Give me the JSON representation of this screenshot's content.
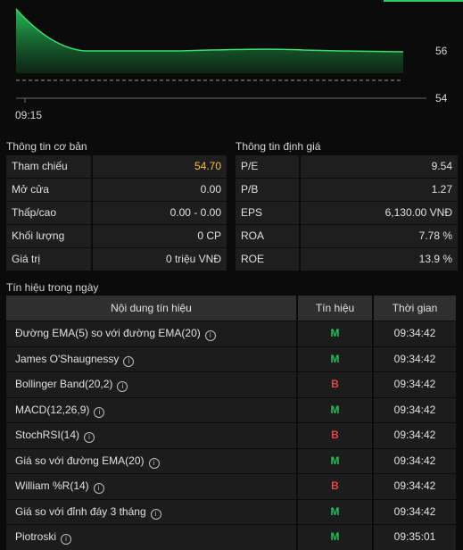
{
  "chart": {
    "y_ticks": [
      "56",
      "54"
    ],
    "x_ticks": [
      "09:15"
    ]
  },
  "basic": {
    "title": "Thông tin cơ bản",
    "rows": [
      {
        "label": "Tham chiếu",
        "value": "54.70"
      },
      {
        "label": "Mở cửa",
        "value": "0.00"
      },
      {
        "label": "Thấp/cao",
        "value": "0.00 - 0.00"
      },
      {
        "label": "Khối lượng",
        "value": "0 CP"
      },
      {
        "label": "Giá trị",
        "value": "0 triệu VNĐ"
      }
    ]
  },
  "valuation": {
    "title": "Thông tin định giá",
    "rows": [
      {
        "label": "P/E",
        "value": "9.54"
      },
      {
        "label": "P/B",
        "value": "1.27"
      },
      {
        "label": "EPS",
        "value": "6,130.00 VNĐ"
      },
      {
        "label": "ROA",
        "value": "7.78 %"
      },
      {
        "label": "ROE",
        "value": "13.9 %"
      }
    ]
  },
  "signals": {
    "title": "Tín hiệu trong ngày",
    "headers": [
      "Nội dung tín hiệu",
      "Tín hiệu",
      "Thời gian"
    ],
    "rows": [
      {
        "name": "Đường EMA(5) so với đường EMA(20)",
        "signal": "M",
        "time": "09:34:42"
      },
      {
        "name": "James O'Shaugnessy",
        "signal": "M",
        "time": "09:34:42"
      },
      {
        "name": "Bollinger Band(20,2)",
        "signal": "B",
        "time": "09:34:42"
      },
      {
        "name": "MACD(12,26,9)",
        "signal": "M",
        "time": "09:34:42"
      },
      {
        "name": "StochRSI(14)",
        "signal": "B",
        "time": "09:34:42"
      },
      {
        "name": "Giá so với đường EMA(20)",
        "signal": "M",
        "time": "09:34:42"
      },
      {
        "name": "William %R(14)",
        "signal": "B",
        "time": "09:34:42"
      },
      {
        "name": "Giá so với đỉnh đáy 3 tháng",
        "signal": "M",
        "time": "09:34:42"
      },
      {
        "name": "Piotroski",
        "signal": "M",
        "time": "09:35:01"
      }
    ]
  },
  "colors": {
    "buy": "#25c05a",
    "sell": "#e04848",
    "accent": "#f5c046",
    "line": "#2ecc60"
  }
}
